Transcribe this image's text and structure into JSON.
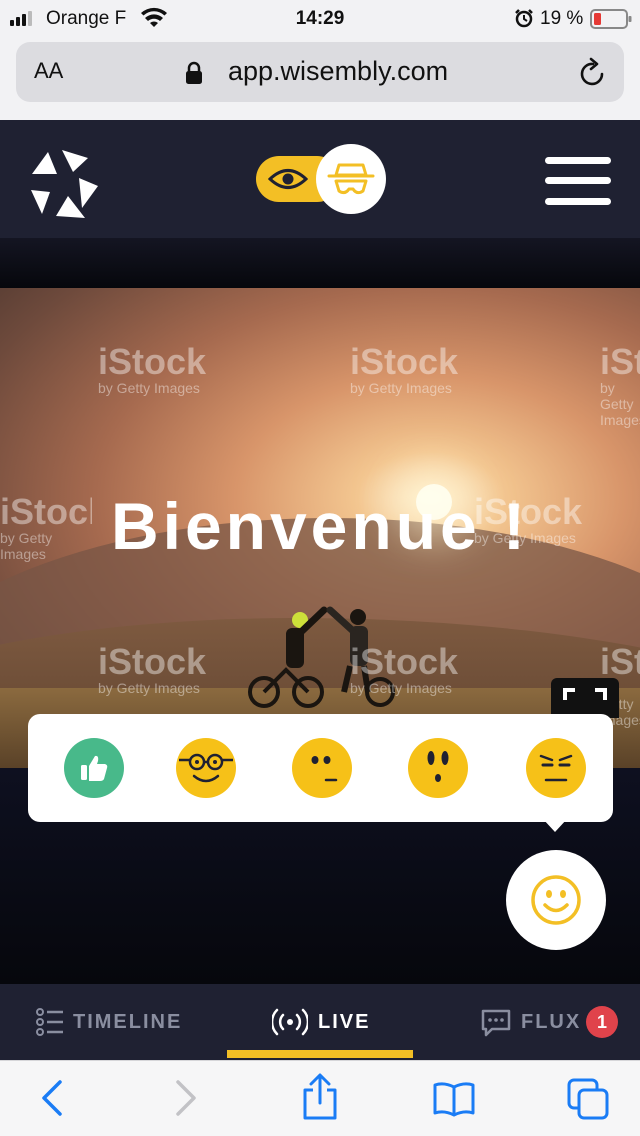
{
  "status_bar": {
    "carrier": "Orange F",
    "time": "14:29",
    "battery_percent": "19 %"
  },
  "browser": {
    "text_size_label": "AA",
    "url": "app.wisembly.com"
  },
  "app": {
    "logo_icon": "wisembly-logo",
    "mode_toggle": {
      "left_icon": "eye-icon",
      "right_icon": "incognito-icon",
      "selected": "incognito"
    }
  },
  "hero": {
    "title": "Bienvenue !",
    "watermark": "iStock",
    "watermark_sub": "by Getty Images"
  },
  "reactions": [
    {
      "name": "thumbs-up",
      "icon": "thumbs-up-icon",
      "color": "#48b98a"
    },
    {
      "name": "nerd",
      "icon": "nerd-face-icon",
      "color": "#f6c118"
    },
    {
      "name": "unsure",
      "icon": "unsure-face-icon",
      "color": "#f6c118"
    },
    {
      "name": "surprised",
      "icon": "surprised-face-icon",
      "color": "#f6c118"
    },
    {
      "name": "angry",
      "icon": "angry-face-icon",
      "color": "#f6c118"
    }
  ],
  "tabs": [
    {
      "label": "TIMELINE",
      "icon": "timeline-icon",
      "active": false
    },
    {
      "label": "LIVE",
      "icon": "broadcast-icon",
      "active": true
    },
    {
      "label": "FLUX",
      "icon": "chat-icon",
      "active": false,
      "badge": "1"
    }
  ],
  "colors": {
    "accent": "#f3bf25",
    "header_bg": "#1f2132",
    "badge_red": "#e0434b",
    "reaction_green": "#48b98a",
    "ios_blue": "#1a7cf5"
  }
}
